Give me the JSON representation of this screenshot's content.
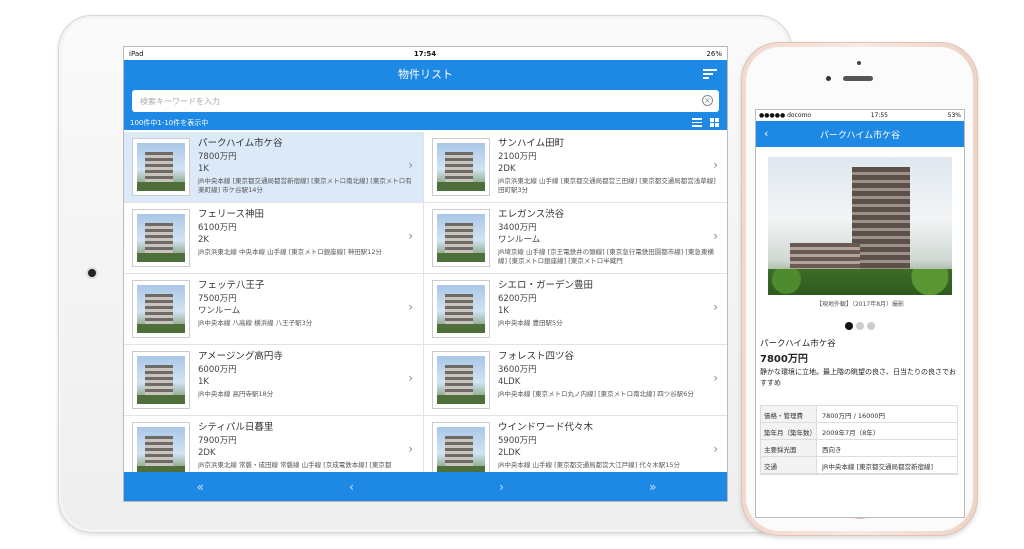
{
  "ipad": {
    "status": {
      "device": "iPad",
      "time": "17:54",
      "battery": "26%"
    },
    "nav_title": "物件リスト",
    "search_placeholder": "検索キーワードを入力",
    "count_text": "100件中1-10件を表示中",
    "properties": [
      {
        "name": "パークハイム市ケ谷",
        "price": "7800万円",
        "layout": "1K",
        "access": "JR中央本線 [東京都交通局都営新宿線] [東京メトロ南北線] [東京メトロ有楽町線] 市ケ谷駅14分",
        "selected": true
      },
      {
        "name": "サンハイム田町",
        "price": "2100万円",
        "layout": "2DK",
        "access": "JR京浜東北線 山手線 [東京都交通局都営三田線] [東京都交通局都営浅草線] 田町駅3分",
        "selected": false
      },
      {
        "name": "フェリース神田",
        "price": "6100万円",
        "layout": "2K",
        "access": "JR京浜東北線 中央本線 山手線 [東京メトロ銀座線] 神田駅12分",
        "selected": false
      },
      {
        "name": "エレガンス渋谷",
        "price": "3400万円",
        "layout": "ワンルーム",
        "access": "JR埼京線 山手線 [京王電鉄井の頭線] [東京急行電鉄田園都市線] [東急東横線] [東京メトロ銀座線] [東京メトロ半蔵門",
        "selected": false
      },
      {
        "name": "フェッテ八王子",
        "price": "7500万円",
        "layout": "ワンルーム",
        "access": "JR中央本線 八高線 横浜線 八王子駅3分",
        "selected": false
      },
      {
        "name": "シエロ・ガーデン豊田",
        "price": "6200万円",
        "layout": "1K",
        "access": "JR中央本線 豊田駅5分",
        "selected": false
      },
      {
        "name": "アメージング高円寺",
        "price": "6000万円",
        "layout": "1K",
        "access": "JR中央本線 高円寺駅18分",
        "selected": false
      },
      {
        "name": "フォレスト四ツ谷",
        "price": "3600万円",
        "layout": "4LDK",
        "access": "JR中央本線 [東京メトロ丸ノ内線] [東京メトロ南北線] 四ツ谷駅6分",
        "selected": false
      },
      {
        "name": "シティパル日暮里",
        "price": "7900万円",
        "layout": "2DK",
        "access": "JR京浜東北線 常磐・成田線 常磐線 山手線 [京成電鉄本線] [東京都",
        "selected": false
      },
      {
        "name": "ウインドワード代々木",
        "price": "5900万円",
        "layout": "2LDK",
        "access": "JR中央本線 山手線 [東京都交通局都営大江戸線] 代々木駅15分",
        "selected": false
      }
    ],
    "pager": {
      "first": "«",
      "prev": "‹",
      "next": "›",
      "last": "»"
    },
    "chevron": "›"
  },
  "iphone": {
    "status": {
      "carrier": "●●●●● docomo",
      "time": "17:55",
      "battery": "53%"
    },
    "back": "‹",
    "nav_title": "パークハイム市ケ谷",
    "photo_caption": "【現地外観】（2017年8月）撮影",
    "name": "パークハイム市ケ谷",
    "price": "7800万円",
    "description": "静かな環境に立地。最上階の眺望の良さ、日当たりの良さでおすすめ",
    "details": [
      {
        "key": "価格・管理費",
        "value": "7800万円 / 16000円"
      },
      {
        "key": "築年月（築年数）",
        "value": "2009年7月（8年）"
      },
      {
        "key": "主要採光面",
        "value": "西向き"
      },
      {
        "key": "交通",
        "value": "JR中央本線 [東京都交通局都営新宿線]"
      }
    ]
  }
}
